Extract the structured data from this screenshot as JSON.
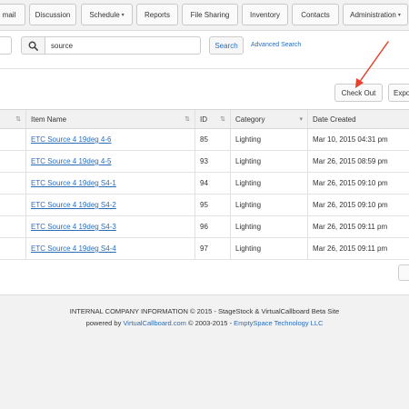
{
  "nav": {
    "email": "mail",
    "discussion": "Discussion",
    "schedule": "Schedule",
    "reports": "Reports",
    "file_sharing": "File Sharing",
    "inventory": "Inventory",
    "contacts": "Contacts",
    "administration": "Administration",
    "caret": "▾"
  },
  "search": {
    "value": "source",
    "button_label": "Search",
    "advanced_label": "Advanced Search",
    "icon": "search-icon"
  },
  "actions": {
    "check_out_label": "Check Out",
    "export_label": "Expo"
  },
  "table": {
    "columns": {
      "item_name": "Item Name",
      "id": "ID",
      "category": "Category",
      "date_created": "Date Created"
    },
    "sort_indicator": "⇅",
    "category_caret": "▾",
    "rows": [
      {
        "name": "ETC Source 4 19deg 4-6",
        "id": "85",
        "category": "Lighting",
        "date": "Mar 10, 2015 04:31 pm"
      },
      {
        "name": "ETC Source 4 19deg 4-5",
        "id": "93",
        "category": "Lighting",
        "date": "Mar 26, 2015 08:59 pm"
      },
      {
        "name": "ETC Source 4 19deg S4-1",
        "id": "94",
        "category": "Lighting",
        "date": "Mar 26, 2015 09:10 pm"
      },
      {
        "name": "ETC Source 4 19deg S4-2",
        "id": "95",
        "category": "Lighting",
        "date": "Mar 26, 2015 09:10 pm"
      },
      {
        "name": "ETC Source 4 19deg S4-3",
        "id": "96",
        "category": "Lighting",
        "date": "Mar 26, 2015 09:11 pm"
      },
      {
        "name": "ETC Source 4 19deg S4-4",
        "id": "97",
        "category": "Lighting",
        "date": "Mar 26, 2015 09:11 pm"
      }
    ]
  },
  "footer": {
    "line1": "INTERNAL COMPANY INFORMATION © 2015 - StageStock & VirtualCallboard Beta Site",
    "powered_prefix": "powered by ",
    "vc_link": "VirtualCallboard.com",
    "middle": " © 2003-2015 - ",
    "es_link": "EmptySpace Technology LLC"
  },
  "colors": {
    "link": "#2a6db7",
    "annotation_arrow": "#e8412c"
  }
}
